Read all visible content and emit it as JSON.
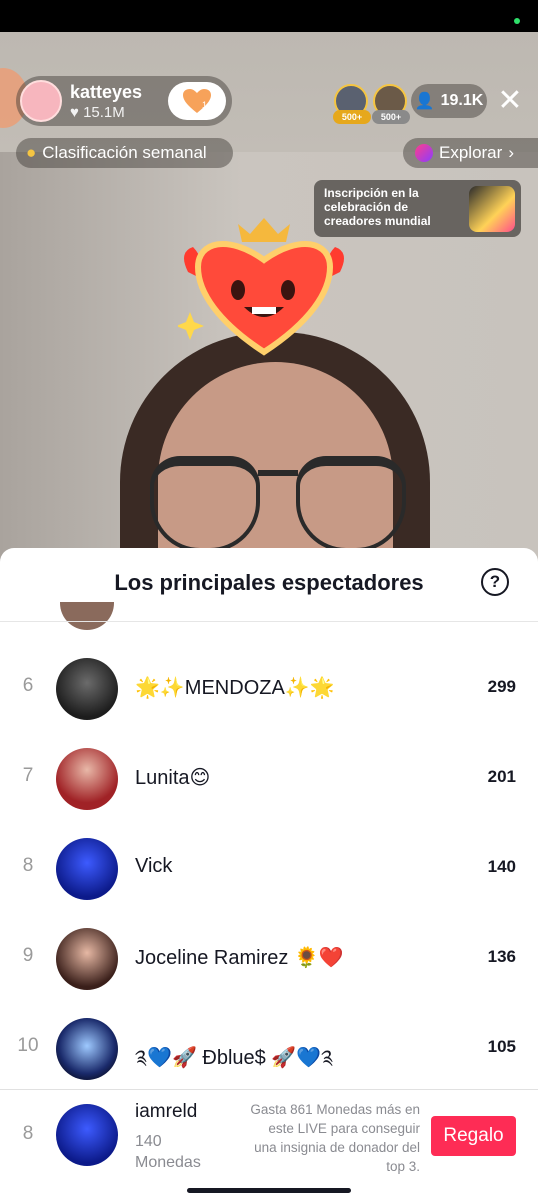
{
  "host": {
    "name": "katteyes",
    "likes": "15.1M"
  },
  "top_bar": {
    "gifter_1_badge": "500+",
    "gifter_2_badge": "500+",
    "viewer_count": "19.1K"
  },
  "pills": {
    "ranking": "Clasificación semanal",
    "explore": "Explorar"
  },
  "promo": {
    "text": "Inscripción en la celebración de creadores mundial"
  },
  "sheet": {
    "title": "Los principales espectadores",
    "rows": [
      {
        "rank": "6",
        "name": "🌟✨MENDOZA✨🌟",
        "score": "299"
      },
      {
        "rank": "7",
        "name": "Lunita😊",
        "score": "201"
      },
      {
        "rank": "8",
        "name": "Vick",
        "score": "140"
      },
      {
        "rank": "9",
        "name": "Joceline Ramirez 🌻❤️",
        "score": "136"
      },
      {
        "rank": "10",
        "name": "༉💙🚀 Ðblue$ 🚀💙༉",
        "score": "105"
      }
    ]
  },
  "footer": {
    "rank": "8",
    "name": "iamreld",
    "coins": "140 Monedas",
    "hint": "Gasta 861 Monedas más en este LIVE para conseguir una insignia de donador del top 3.",
    "gift_label": "Regalo"
  },
  "colors": {
    "accent": "#fe2c55",
    "text_primary": "#161823",
    "text_secondary": "#8a8b91"
  }
}
